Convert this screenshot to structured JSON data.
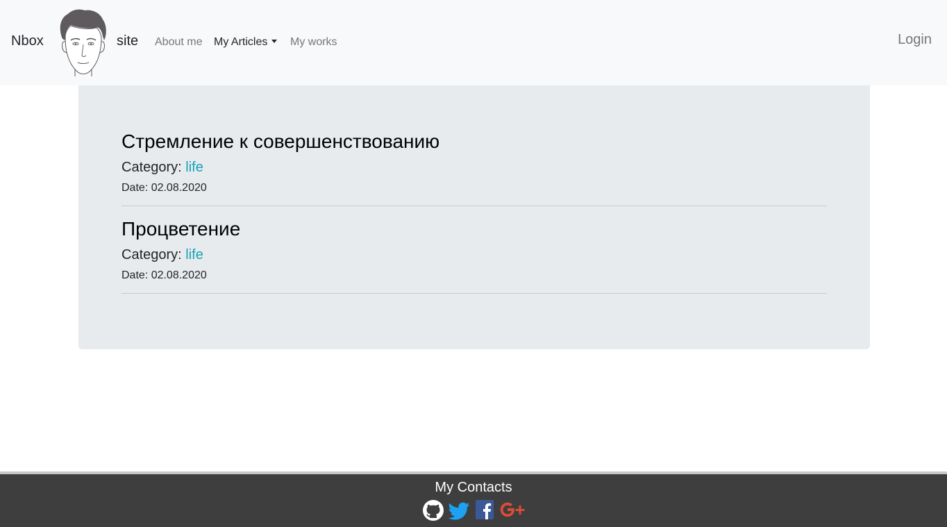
{
  "nav": {
    "brand_left": "Nbox",
    "brand_right": "site",
    "about": "About me",
    "articles": "My Articles",
    "works": "My works",
    "login": "Login"
  },
  "articles": [
    {
      "title": "Стремление к совершенствованию",
      "category_label": "Category:",
      "category": "life",
      "date": "Date: 02.08.2020"
    },
    {
      "title": "Процветение",
      "category_label": "Category:",
      "category": "life",
      "date": "Date: 02.08.2020"
    }
  ],
  "footer": {
    "title": "My Contacts",
    "icons": [
      "github-icon",
      "twitter-icon",
      "facebook-icon",
      "google-plus-icon"
    ]
  },
  "colors": {
    "link": "#17a2b8",
    "footer_bg": "#3e3e3e",
    "twitter": "#1da1f2",
    "facebook": "#3b5998",
    "google_plus": "#dd4b39"
  }
}
